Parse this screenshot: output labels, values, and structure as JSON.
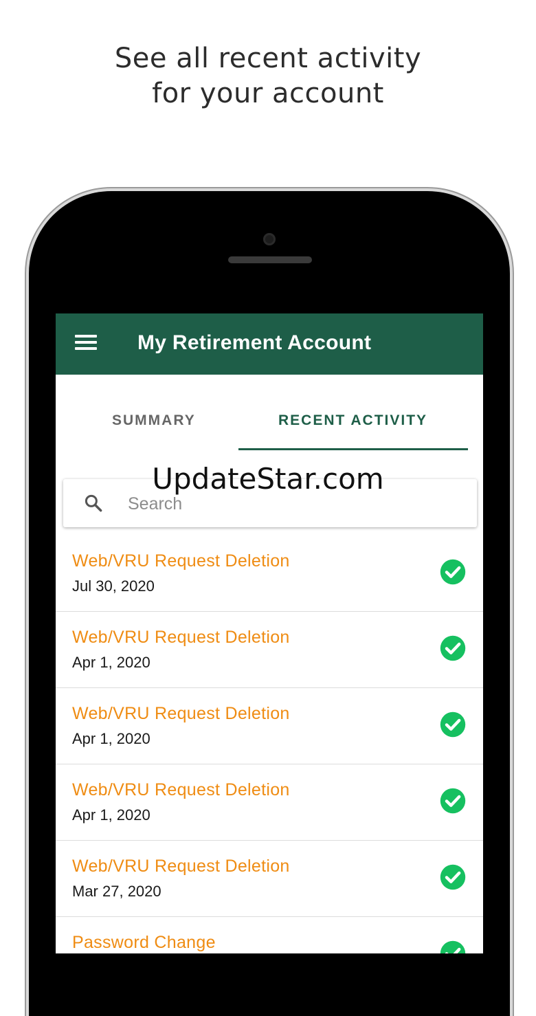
{
  "promo": {
    "headline_line1": "See all recent activity",
    "headline_line2": "for your account"
  },
  "watermark": "UpdateStar.com",
  "app_bar": {
    "title": "My Retirement Account",
    "menu_icon": "hamburger-menu-icon",
    "color": "#1e5e48"
  },
  "tabs": [
    {
      "label": "SUMMARY",
      "selected": false
    },
    {
      "label": "RECENT ACTIVITY",
      "selected": true
    }
  ],
  "search": {
    "placeholder": "Search",
    "value": "",
    "icon": "search-icon"
  },
  "activity": [
    {
      "title": "Web/VRU Request Deletion",
      "date": "Jul 30, 2020",
      "status": "complete"
    },
    {
      "title": "Web/VRU Request Deletion",
      "date": "Apr 1, 2020",
      "status": "complete"
    },
    {
      "title": "Web/VRU Request Deletion",
      "date": "Apr 1, 2020",
      "status": "complete"
    },
    {
      "title": "Web/VRU Request Deletion",
      "date": "Apr 1, 2020",
      "status": "complete"
    },
    {
      "title": "Web/VRU Request Deletion",
      "date": "Mar 27, 2020",
      "status": "complete"
    },
    {
      "title": "Password Change",
      "date": "",
      "status": "complete"
    }
  ],
  "colors": {
    "accent_orange": "#ef8c13",
    "status_green": "#16c060"
  }
}
